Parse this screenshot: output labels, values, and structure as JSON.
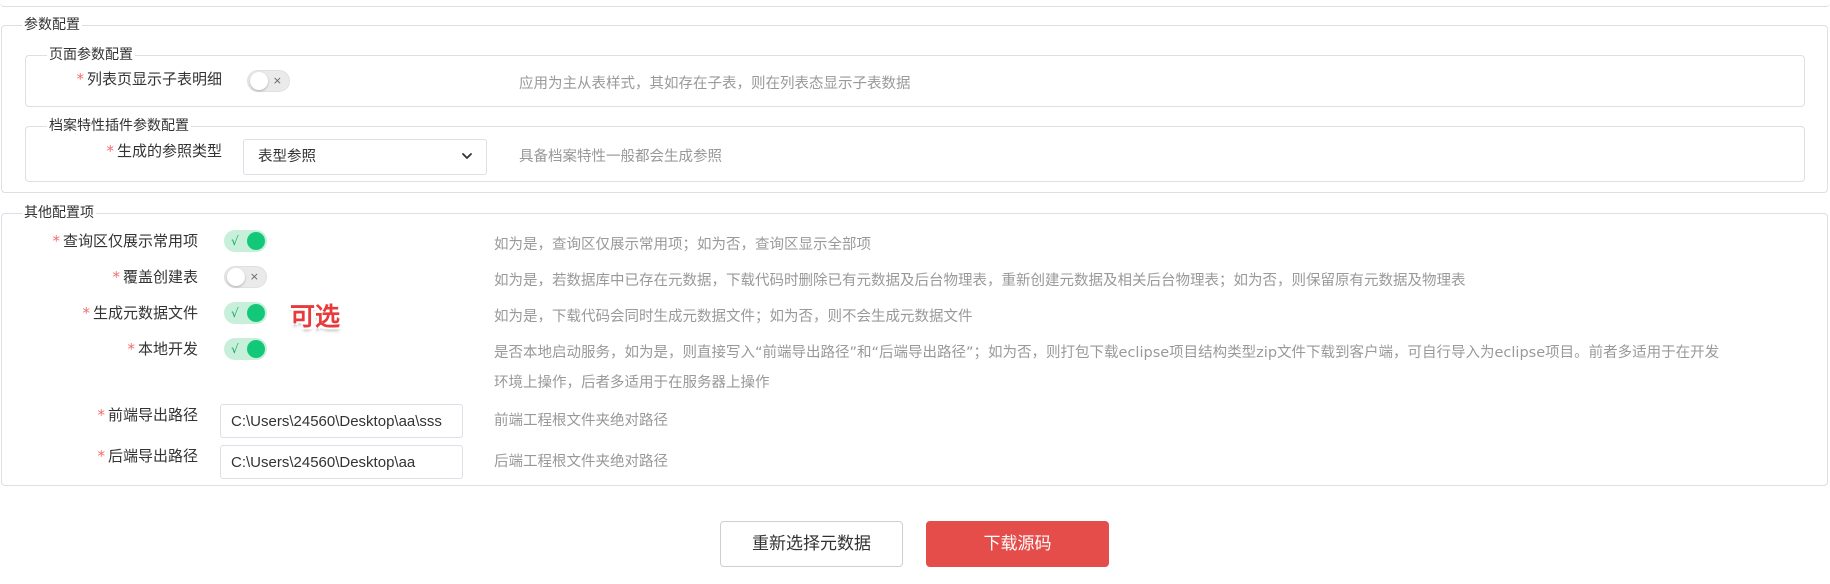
{
  "param_config": {
    "legend": "参数配置",
    "page_params": {
      "legend": "页面参数配置",
      "show_child_detail": {
        "label": "列表页显示子表明细",
        "state": "off",
        "mark": "×",
        "desc": "应用为主从表样式，其如存在子表，则在列表态显示子表数据"
      }
    },
    "archive_plugin": {
      "legend": "档案特性插件参数配置",
      "ref_type": {
        "label": "生成的参照类型",
        "value": "表型参照",
        "desc": "具备档案特性一般都会生成参照"
      }
    }
  },
  "other_config": {
    "legend": "其他配置项",
    "query_common": {
      "label": "查询区仅展示常用项",
      "state": "on",
      "mark": "√",
      "desc": "如为是，查询区仅展示常用项；如为否，查询区显示全部项"
    },
    "overwrite_table": {
      "label": "覆盖创建表",
      "state": "off",
      "mark": "×",
      "desc": "如为是，若数据库中已存在元数据，下载代码时删除已有元数据及后台物理表，重新创建元数据及相关后台物理表；如为否，则保留原有元数据及物理表"
    },
    "gen_metadata": {
      "label": "生成元数据文件",
      "state": "on",
      "mark": "√",
      "annotation": "可选",
      "desc": "如为是，下载代码会同时生成元数据文件；如为否，则不会生成元数据文件"
    },
    "local_dev": {
      "label": "本地开发",
      "state": "on",
      "mark": "√",
      "desc_line1": "是否本地启动服务，如为是，则直接写入“前端导出路径”和“后端导出路径”；如为否，则打包下载eclipse项目结构类型zip文件下载到客户端，可自行导入为eclipse项目。前者多适用于在开发",
      "desc_line2": "环境上操作，后者多适用于在服务器上操作"
    },
    "frontend_path": {
      "label": "前端导出路径",
      "value": "C:\\Users\\24560\\Desktop\\aa\\sss",
      "desc": "前端工程根文件夹绝对路径"
    },
    "backend_path": {
      "label": "后端导出路径",
      "value": "C:\\Users\\24560\\Desktop\\aa",
      "desc": "后端工程根文件夹绝对路径"
    }
  },
  "actions": {
    "reselect_label": "重新选择元数据",
    "download_label": "下载源码"
  },
  "colors": {
    "required": "#f56c6c",
    "switch_on": "#14c87a",
    "primary_button": "#e44d4a",
    "annotation": "#e83a3a"
  }
}
